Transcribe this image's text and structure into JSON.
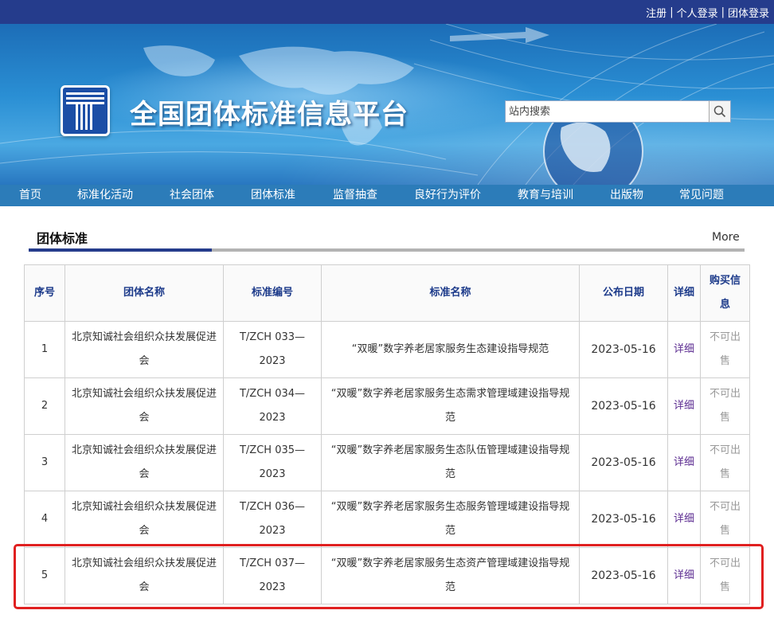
{
  "topbar": {
    "links": [
      "注册",
      "个人登录",
      "团体登录"
    ],
    "separator": "|"
  },
  "banner": {
    "title": "全国团体标准信息平台",
    "search_placeholder": "站内搜索",
    "search_icon": "search-icon"
  },
  "nav": {
    "items": [
      "首页",
      "标准化活动",
      "社会团体",
      "团体标准",
      "监督抽查",
      "良好行为评价",
      "教育与培训",
      "出版物",
      "常见问题"
    ]
  },
  "section": {
    "title": "团体标准",
    "more": "More"
  },
  "table": {
    "headers": [
      "序号",
      "团体名称",
      "标准编号",
      "标准名称",
      "公布日期",
      "详细",
      "购买信息"
    ],
    "rows": [
      {
        "no": "1",
        "org": "北京知诚社会组织众扶发展促进会",
        "code": "T/ZCH 033—2023",
        "name": "“双暖”数字养老居家服务生态建设指导规范",
        "date": "2023-05-16",
        "detail": "详细",
        "buy": "不可出售"
      },
      {
        "no": "2",
        "org": "北京知诚社会组织众扶发展促进会",
        "code": "T/ZCH 034—2023",
        "name": "“双暖”数字养老居家服务生态需求管理域建设指导规范",
        "date": "2023-05-16",
        "detail": "详细",
        "buy": "不可出售"
      },
      {
        "no": "3",
        "org": "北京知诚社会组织众扶发展促进会",
        "code": "T/ZCH 035—2023",
        "name": "“双暖”数字养老居家服务生态队伍管理域建设指导规范",
        "date": "2023-05-16",
        "detail": "详细",
        "buy": "不可出售"
      },
      {
        "no": "4",
        "org": "北京知诚社会组织众扶发展促进会",
        "code": "T/ZCH 036—2023",
        "name": "“双暖”数字养老居家服务生态服务管理域建设指导规范",
        "date": "2023-05-16",
        "detail": "详细",
        "buy": "不可出售"
      },
      {
        "no": "5",
        "org": "北京知诚社会组织众扶发展促进会",
        "code": "T/ZCH 037—2023",
        "name": "“双暖”数字养老居家服务生态资产管理域建设指导规范",
        "date": "2023-05-16",
        "detail": "详细",
        "buy": "不可出售"
      }
    ]
  },
  "colors": {
    "topbar": "#253c8c",
    "nav": "#2c7cb9",
    "header_text": "#1c3a8a",
    "detail_link": "#5c2c91",
    "highlight": "#e02020"
  }
}
